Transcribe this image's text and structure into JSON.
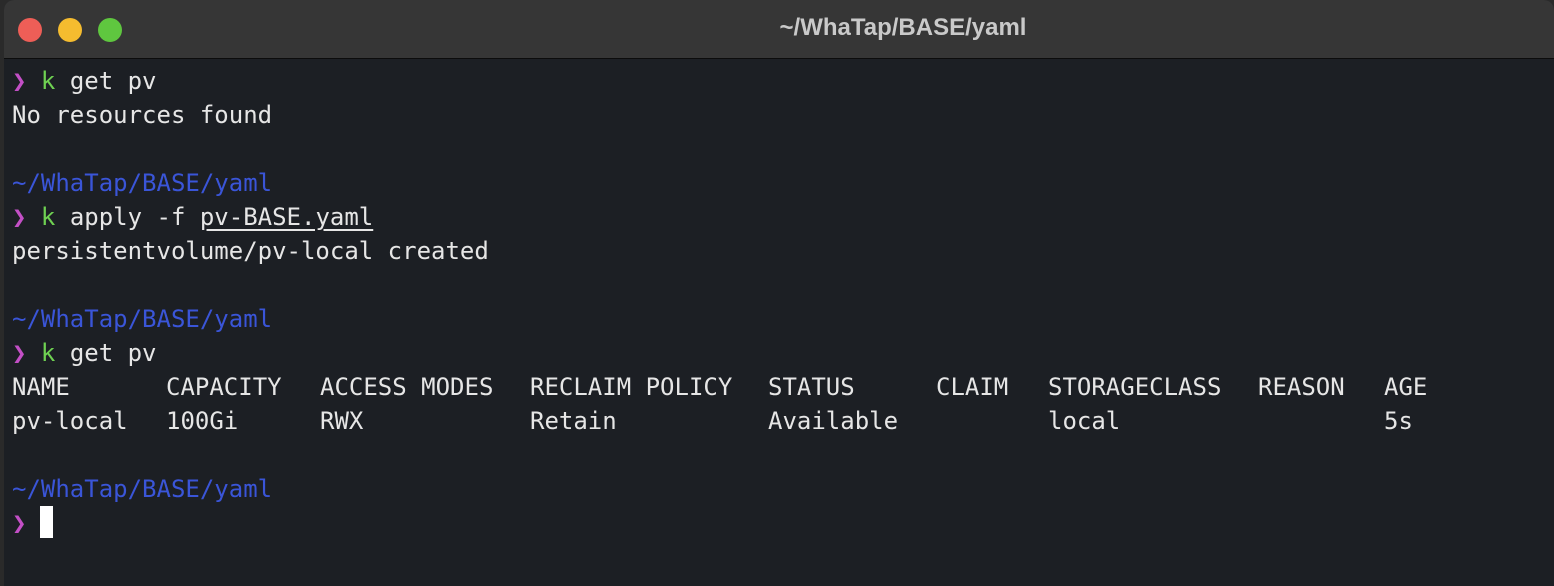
{
  "window": {
    "title": "~/WhaTap/BASE/yaml"
  },
  "terminal": {
    "prompt_symbol": "❯",
    "blocks": [
      {
        "command": {
          "alias": "k",
          "args": "get pv"
        },
        "output": "No resources found"
      },
      {
        "path": "~/WhaTap/BASE/yaml",
        "command": {
          "alias": "k",
          "args_prefix": "apply -f",
          "file": "pv-BASE.yaml"
        },
        "output": "persistentvolume/pv-local created"
      },
      {
        "path": "~/WhaTap/BASE/yaml",
        "command": {
          "alias": "k",
          "args": "get pv"
        },
        "table": {
          "headers": [
            "NAME",
            "CAPACITY",
            "ACCESS MODES",
            "RECLAIM POLICY",
            "STATUS",
            "CLAIM",
            "STORAGECLASS",
            "REASON",
            "AGE"
          ],
          "rows": [
            [
              "pv-local",
              "100Gi",
              "RWX",
              "Retain",
              "Available",
              "",
              "local",
              "",
              "5s"
            ]
          ]
        }
      },
      {
        "path": "~/WhaTap/BASE/yaml"
      }
    ]
  },
  "colors": {
    "background": "#1c1f24",
    "prompt": "#c34fc6",
    "alias": "#6fd152",
    "path": "#3a55d8",
    "text": "#e6e6e6"
  }
}
